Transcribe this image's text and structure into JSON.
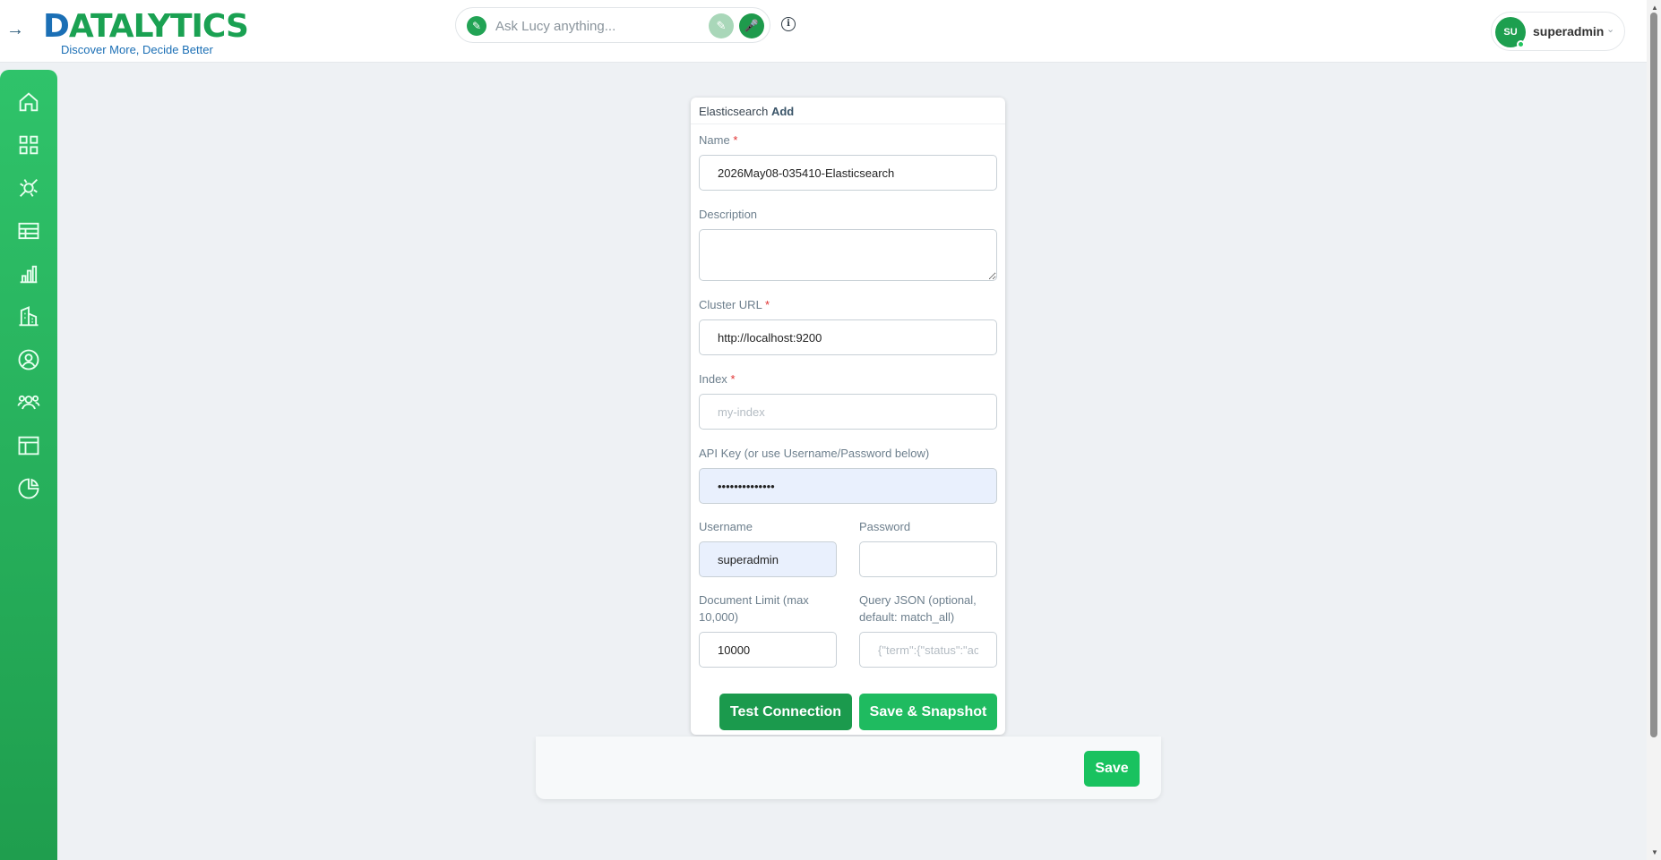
{
  "header": {
    "logo_text_main": "ATALYTICS",
    "logo_text_d": "D",
    "logo_tagline": "Discover More, Decide Better",
    "search_placeholder": "Ask Lucy anything...",
    "user_initials": "SU",
    "username": "superadmin"
  },
  "sidebar": {
    "items": [
      "home-icon",
      "dashboard-grid-icon",
      "connectors-icon",
      "table-icon",
      "bar-chart-icon",
      "buildings-icon",
      "user-circle-icon",
      "users-group-icon",
      "layout-icon",
      "pie-chart-icon"
    ]
  },
  "form": {
    "title_source": "Elasticsearch",
    "title_action": "Add",
    "name": {
      "label": "Name",
      "required_mark": "*",
      "value": "2026May08-035410-Elasticsearch"
    },
    "description": {
      "label": "Description",
      "value": ""
    },
    "cluster_url": {
      "label": "Cluster URL",
      "required_mark": "*",
      "value": "http://localhost:9200"
    },
    "index": {
      "label": "Index",
      "required_mark": "*",
      "value": "",
      "placeholder": "my-index"
    },
    "api_key": {
      "label": "API Key (or use Username/Password below)",
      "value": "••••••••••••••"
    },
    "username": {
      "label": "Username",
      "value": "superadmin"
    },
    "password": {
      "label": "Password",
      "value": ""
    },
    "doc_limit": {
      "label": "Document Limit (max 10,000)",
      "value": "10000"
    },
    "query_json": {
      "label": "Query JSON (optional, default: match_all)",
      "value": "",
      "placeholder": "{\"term\":{\"status\":\"active\"}}"
    },
    "test_button": "Test Connection",
    "snapshot_button": "Save & Snapshot"
  },
  "footer": {
    "save_button": "Save"
  },
  "colors": {
    "brand_green": "#1fbb60",
    "dark_green": "#1b9a4d",
    "brand_blue": "#1b6fb5"
  }
}
